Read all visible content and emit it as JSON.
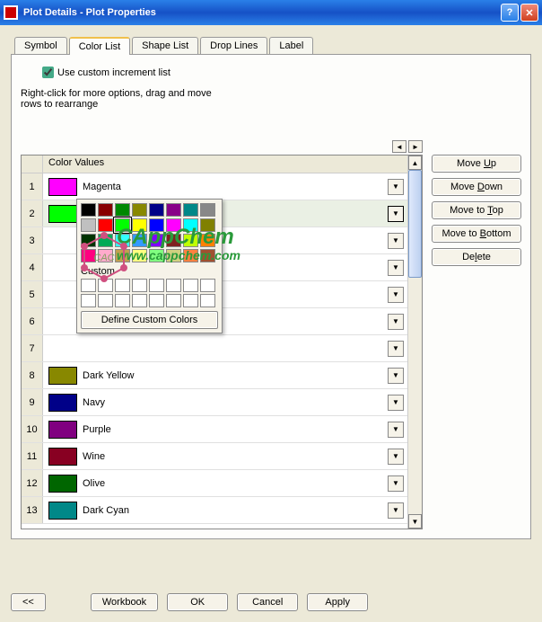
{
  "window": {
    "title": "Plot Details - Plot Properties"
  },
  "tabs": [
    "Symbol",
    "Color List",
    "Shape List",
    "Drop Lines",
    "Label"
  ],
  "active_tab": 1,
  "checkbox": {
    "label": "Use custom increment list",
    "checked": true
  },
  "hint": "Right-click for more options, drag and move\nrows to  rearrange",
  "column_header": "Color Values",
  "rows": [
    {
      "n": 1,
      "name": "Magenta",
      "color": "#ff00ff"
    },
    {
      "n": 2,
      "name": "Green",
      "color": "#00ff00",
      "selected": true,
      "open": true
    },
    {
      "n": 3,
      "name": "",
      "color": ""
    },
    {
      "n": 4,
      "name": "",
      "color": ""
    },
    {
      "n": 5,
      "name": "",
      "color": ""
    },
    {
      "n": 6,
      "name": "",
      "color": ""
    },
    {
      "n": 7,
      "name": "",
      "color": ""
    },
    {
      "n": 8,
      "name": "Dark Yellow",
      "color": "#888800"
    },
    {
      "n": 9,
      "name": "Navy",
      "color": "#000088"
    },
    {
      "n": 10,
      "name": "Purple",
      "color": "#800080"
    },
    {
      "n": 11,
      "name": "Wine",
      "color": "#880022"
    },
    {
      "n": 12,
      "name": "Olive",
      "color": "#006600"
    },
    {
      "n": 13,
      "name": "Dark Cyan",
      "color": "#008888"
    }
  ],
  "side_buttons": {
    "move_up": "Move Up",
    "move_down": "Move Down",
    "move_top": "Move to Top",
    "move_bottom": "Move to Bottom",
    "delete": "Delete"
  },
  "colorpicker": {
    "basic": [
      "#000000",
      "#880000",
      "#008800",
      "#888800",
      "#000088",
      "#880088",
      "#008888",
      "#888888",
      "#c0c0c0",
      "#ff0000",
      "#00ff00",
      "#ffff00",
      "#0000ff",
      "#ff00ff",
      "#00ffff",
      "#808000",
      "#003300",
      "#00aa55",
      "#33ffff",
      "#3399ff",
      "#8000ff",
      "#802020",
      "#c0ff00",
      "#ff8000",
      "#ff0080",
      "#ffaacc",
      "#c0a050",
      "#ffff80",
      "#80ff80",
      "#d0d080",
      "#ff8040",
      "#a05030"
    ],
    "selected_index": 10,
    "custom_label": "Custom",
    "custom": [
      "#ffffff",
      "#ffffff",
      "#ffffff",
      "#ffffff",
      "#ffffff",
      "#ffffff",
      "#ffffff",
      "#ffffff",
      "#ffffff",
      "#ffffff",
      "#ffffff",
      "#ffffff",
      "#ffffff",
      "#ffffff",
      "#ffffff",
      "#ffffff"
    ],
    "define_btn": "Define Custom Colors"
  },
  "bottom": {
    "collapse": "<<",
    "workbook": "Workbook",
    "ok": "OK",
    "cancel": "Cancel",
    "apply": "Apply"
  },
  "watermark": {
    "line1": "CAppChem",
    "line2": "www.cappchem.com"
  }
}
